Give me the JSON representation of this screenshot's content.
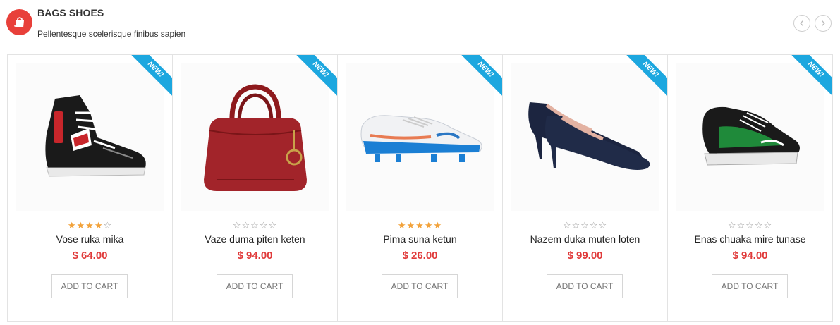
{
  "section": {
    "title": "BAGS SHOES",
    "subtitle": "Pellentesque scelerisque finibus sapien",
    "icon": "shopping-bag-icon",
    "accent_color": "#e8403a"
  },
  "navigation": {
    "prev_icon": "chevron-left-icon",
    "next_icon": "chevron-right-icon"
  },
  "products": [
    {
      "name": "Vose ruka mika",
      "price": "$ 64.00",
      "rating": 4,
      "badge": "NEW!",
      "cart_label": "ADD TO CART",
      "image": "high-top-sneaker"
    },
    {
      "name": "Vaze duma piten keten",
      "price": "$ 94.00",
      "rating": 0,
      "badge": "NEW!",
      "cart_label": "ADD TO CART",
      "image": "red-handbag"
    },
    {
      "name": "Pima suna ketun",
      "price": "$ 26.00",
      "rating": 5,
      "badge": "NEW!",
      "cart_label": "ADD TO CART",
      "image": "football-boot"
    },
    {
      "name": "Nazem duka muten loten",
      "price": "$ 99.00",
      "rating": 0,
      "badge": "NEW!",
      "cart_label": "ADD TO CART",
      "image": "navy-pump-heel"
    },
    {
      "name": "Enas chuaka mire tunase",
      "price": "$ 94.00",
      "rating": 0,
      "badge": "NEW!",
      "cart_label": "ADD TO CART",
      "image": "green-running-shoe"
    }
  ],
  "colors": {
    "price": "#e03a3a",
    "ribbon": "#1da7df",
    "star_on": "#f2a23a"
  }
}
